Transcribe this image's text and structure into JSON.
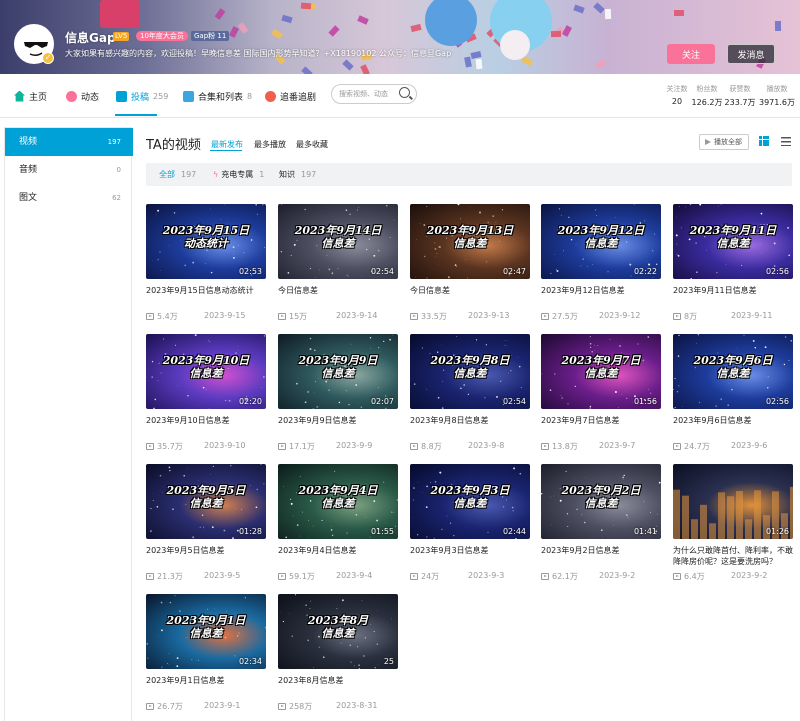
{
  "header": {
    "username": "信息Gap",
    "level": "LV5",
    "vip_badge": "10年度大会员",
    "gap_badge": "Gap粉 11",
    "signature": "大家如果有感兴趣的内容，欢迎投稿！早晚信息差 国际国内形势早知道？+X18190102 公众号：信息旦Gap",
    "follow_label": "关注",
    "message_label": "发消息"
  },
  "nav": {
    "items": [
      {
        "label": "主页",
        "count": ""
      },
      {
        "label": "动态",
        "count": ""
      },
      {
        "label": "投稿",
        "count": "259"
      },
      {
        "label": "合集和列表",
        "count": "8"
      },
      {
        "label": "追番追剧",
        "count": ""
      }
    ],
    "search_placeholder": "搜索视频、动态"
  },
  "stats": [
    {
      "label": "关注数",
      "value": "20"
    },
    {
      "label": "粉丝数",
      "value": "126.2万"
    },
    {
      "label": "获赞数",
      "value": "233.7万"
    },
    {
      "label": "播放数",
      "value": "3971.6万"
    }
  ],
  "sidebar": {
    "items": [
      {
        "label": "视频",
        "count": "197"
      },
      {
        "label": "音频",
        "count": "0"
      },
      {
        "label": "图文",
        "count": "62"
      }
    ]
  },
  "main": {
    "title": "TA的视频",
    "sort_options": [
      "最新发布",
      "最多播放",
      "最多收藏"
    ],
    "play_all": "播放全部",
    "filters": [
      {
        "label": "全部",
        "count": "197"
      },
      {
        "label": "充电专属",
        "count": "1"
      },
      {
        "label": "知识",
        "count": "197"
      }
    ]
  },
  "videos": [
    {
      "thumb_l1": "2023年9月15日",
      "thumb_l2": "动态统计",
      "duration": "02:53",
      "title": "2023年9月15日信息动态统计",
      "views": "5.4万",
      "date": "2023-9-15",
      "theme": "blue"
    },
    {
      "thumb_l1": "2023年9月14日",
      "thumb_l2": "信息差",
      "duration": "02:54",
      "title": "今日信息差",
      "views": "15万",
      "date": "2023-9-14",
      "theme": "gray"
    },
    {
      "thumb_l1": "2023年9月13日",
      "thumb_l2": "信息差",
      "duration": "02:47",
      "title": "今日信息差",
      "views": "33.5万",
      "date": "2023-9-13",
      "theme": "brown"
    },
    {
      "thumb_l1": "2023年9月12日",
      "thumb_l2": "信息差",
      "duration": "02:22",
      "title": "2023年9月12日信息差",
      "views": "27.5万",
      "date": "2023-9-12",
      "theme": "blue"
    },
    {
      "thumb_l1": "2023年9月11日",
      "thumb_l2": "信息差",
      "duration": "02:56",
      "title": "2023年9月11日信息差",
      "views": "8万",
      "date": "2023-9-11",
      "theme": "purple"
    },
    {
      "thumb_l1": "2023年9月10日",
      "thumb_l2": "信息差",
      "duration": "02:20",
      "title": "2023年9月10日信息差",
      "views": "35.7万",
      "date": "2023-9-10",
      "theme": "violet"
    },
    {
      "thumb_l1": "2023年9月9日",
      "thumb_l2": "信息差",
      "duration": "02:07",
      "title": "2023年9月9日信息差",
      "views": "17.1万",
      "date": "2023-9-9",
      "theme": "teal"
    },
    {
      "thumb_l1": "2023年9月8日",
      "thumb_l2": "信息差",
      "duration": "02:54",
      "title": "2023年9月8日信息差",
      "views": "8.8万",
      "date": "2023-9-8",
      "theme": "navy"
    },
    {
      "thumb_l1": "2023年9月7日",
      "thumb_l2": "信息差",
      "duration": "01:56",
      "title": "2023年9月7日信息差",
      "views": "13.8万",
      "date": "2023-9-7",
      "theme": "magenta"
    },
    {
      "thumb_l1": "2023年9月6日",
      "thumb_l2": "信息差",
      "duration": "02:56",
      "title": "2023年9月6日信息差",
      "views": "24.7万",
      "date": "2023-9-6",
      "theme": "blue"
    },
    {
      "thumb_l1": "2023年9月5日",
      "thumb_l2": "信息差",
      "duration": "01:28",
      "title": "2023年9月5日信息差",
      "views": "21.3万",
      "date": "2023-9-5",
      "theme": "dusk"
    },
    {
      "thumb_l1": "2023年9月4日",
      "thumb_l2": "信息差",
      "duration": "01:55",
      "title": "2023年9月4日信息差",
      "views": "59.1万",
      "date": "2023-9-4",
      "theme": "green"
    },
    {
      "thumb_l1": "2023年9月3日",
      "thumb_l2": "信息差",
      "duration": "02:44",
      "title": "2023年9月3日信息差",
      "views": "24万",
      "date": "2023-9-3",
      "theme": "navy"
    },
    {
      "thumb_l1": "2023年9月2日",
      "thumb_l2": "信息差",
      "duration": "01:41",
      "title": "2023年9月2日信息差",
      "views": "62.1万",
      "date": "2023-9-2",
      "theme": "gray"
    },
    {
      "thumb_l1": "",
      "thumb_l2": "",
      "duration": "01:26",
      "title": "为什么只敢降首付、降利率，不敢降降房价呢？这是要洗房吗？",
      "views": "6.4万",
      "date": "2023-9-2",
      "theme": "city"
    },
    {
      "thumb_l1": "2023年9月1日",
      "thumb_l2": "信息差",
      "duration": "02:34",
      "title": "2023年9月1日信息差",
      "views": "26.7万",
      "date": "2023-9-1",
      "theme": "cyan"
    },
    {
      "thumb_l1": "2023年8月",
      "thumb_l2": "信息差",
      "duration": "25",
      "title": "2023年8月信息差",
      "views": "258万",
      "date": "2023-8-31",
      "theme": "dark"
    }
  ]
}
